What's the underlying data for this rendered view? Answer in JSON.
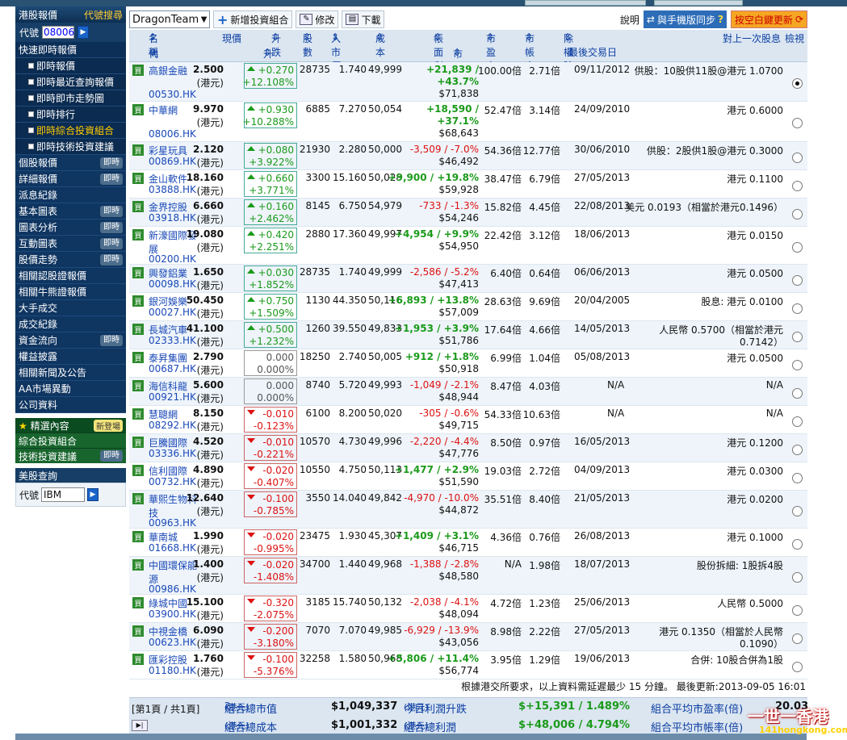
{
  "sidebar": {
    "title": "港股報價",
    "search_link": "代號搜尋",
    "code_label": "代號",
    "code_value": "08006",
    "sections": [
      {
        "label": "快速即時報價",
        "badge": ""
      }
    ],
    "subitems": [
      "即時報價",
      "即時最近查詢報價",
      "即時即市走勢圖",
      "即時排行",
      "即時綜合投資組合",
      "即時技術投資建議"
    ],
    "active_sub": 4,
    "items": [
      {
        "label": "個股報價",
        "badge": "即時"
      },
      {
        "label": "詳細報價",
        "badge": "即時"
      },
      {
        "label": "派息紀錄",
        "badge": ""
      },
      {
        "label": "基本圖表",
        "badge": "即時"
      },
      {
        "label": "圖表分析",
        "badge": "即時"
      },
      {
        "label": "互動圖表",
        "badge": "即時"
      },
      {
        "label": "股價走勢",
        "badge": "即時"
      },
      {
        "label": "相關認股證報價",
        "badge": ""
      },
      {
        "label": "相關牛熊證報價",
        "badge": ""
      },
      {
        "label": "大手成交",
        "badge": ""
      },
      {
        "label": "成交紀錄",
        "badge": ""
      },
      {
        "label": "資金流向",
        "badge": "即時"
      },
      {
        "label": "權益披露",
        "badge": ""
      },
      {
        "label": "相關新聞及公告",
        "badge": ""
      },
      {
        "label": "AA市場異動",
        "badge": ""
      },
      {
        "label": "公司資料",
        "badge": ""
      }
    ],
    "featured": {
      "title": "精選內容",
      "new_badge": "新登場"
    },
    "green_items": [
      {
        "label": "綜合投資組合",
        "badge": ""
      },
      {
        "label": "技術投資建議",
        "badge": "即時"
      }
    ],
    "us": {
      "title": "美股查詢",
      "code_label": "代號",
      "code_value": "IBM"
    }
  },
  "toolbar": {
    "portfolio": "DragonTeam",
    "new_portfolio": "新增投資組合",
    "edit": "修改",
    "download": "下載",
    "help": "說明",
    "sync": "與手機版同步",
    "update": "按空白鍵更新"
  },
  "header": {
    "name": "名稱",
    "code": "代號",
    "price": "現價",
    "change": "升跌",
    "change_pct": "升跌%",
    "shares": "股數",
    "buy_price": "入市價",
    "cost": "成本",
    "book_pl": "帳面利潤/",
    "market_value": "市值",
    "pe": "市盈率",
    "pb": "市帳率",
    "ex_date": "除權除息日/",
    "last_trade": "最後交易日",
    "last_div": "對上一次股息",
    "check": "檢視"
  },
  "buy_label": "買",
  "unit": "(港元)",
  "rows": [
    {
      "name": "高銀金融",
      "code": "00530.HK",
      "price": "2.500",
      "chg": "+0.270",
      "pct": "+12.108%",
      "dir": "up",
      "shares": "28735",
      "bp": "1.740",
      "cost": "49,999",
      "pl": "+21,839 /",
      "pl_pct": "+43.7%",
      "mv": "$71,838",
      "pe": "100.00倍",
      "pb": "2.71倍",
      "date": "09/11/2012",
      "div": "供股：10股供11股@港元 1.0700",
      "div2": "",
      "sel": true,
      "h": 49
    },
    {
      "name": "中華網",
      "code": "08006.HK",
      "price": "9.970",
      "chg": "+0.930",
      "pct": "+10.288%",
      "dir": "up",
      "shares": "6885",
      "bp": "7.270",
      "cost": "50,054",
      "pl": "+18,590 /",
      "pl_pct": "+37.1%",
      "mv": "$68,643",
      "pe": "52.47倍",
      "pb": "3.14倍",
      "date": "24/09/2010",
      "div": "港元 0.6000",
      "div2": "",
      "sel": false,
      "h": 50
    },
    {
      "name": "彩星玩具",
      "code": "00869.HK",
      "price": "2.120",
      "chg": "+0.080",
      "pct": "+3.922%",
      "dir": "up",
      "shares": "21930",
      "bp": "2.280",
      "cost": "50,000",
      "pl": "-3,509 / -7.0%",
      "pl_pct": "",
      "mv": "$46,492",
      "pe": "54.36倍",
      "pb": "12.77倍",
      "date": "30/06/2010",
      "div": "供股：2股供1股@港元 0.3000",
      "div2": "",
      "sel": false,
      "h": 35
    },
    {
      "name": "金山軟件",
      "code": "03888.HK",
      "price": "18.160",
      "chg": "+0.660",
      "pct": "+3.771%",
      "dir": "up",
      "shares": "3300",
      "bp": "15.160",
      "cost": "50,028",
      "pl": "+9,900 / +19.8%",
      "pl_pct": "",
      "mv": "$59,928",
      "pe": "38.47倍",
      "pb": "6.79倍",
      "date": "27/05/2013",
      "div": "港元 0.1100",
      "div2": "",
      "sel": false,
      "h": 35
    },
    {
      "name": "金界控股",
      "code": "03918.HK",
      "price": "6.660",
      "chg": "+0.160",
      "pct": "+2.462%",
      "dir": "up",
      "shares": "8145",
      "bp": "6.750",
      "cost": "54,979",
      "pl": "-733 / -1.3%",
      "pl_pct": "",
      "mv": "$54,246",
      "pe": "15.82倍",
      "pb": "4.45倍",
      "date": "22/08/2013",
      "div": "美元 0.0193（相當於港元0.1496）",
      "div2": "",
      "sel": false,
      "h": 35
    },
    {
      "name": "新濠國際發展",
      "code": "00200.HK",
      "price": "19.080",
      "chg": "+0.420",
      "pct": "+2.251%",
      "dir": "up",
      "shares": "2880",
      "bp": "17.360",
      "cost": "49,997",
      "pl": "+4,954 / +9.9%",
      "pl_pct": "",
      "mv": "$54,950",
      "pe": "22.42倍",
      "pb": "3.12倍",
      "date": "18/06/2013",
      "div": "港元 0.0150",
      "div2": "",
      "sel": false,
      "h": 47
    },
    {
      "name": "興發鋁業",
      "code": "00098.HK",
      "price": "1.650",
      "chg": "+0.030",
      "pct": "+1.852%",
      "dir": "up",
      "shares": "28735",
      "bp": "1.740",
      "cost": "49,999",
      "pl": "-2,586 / -5.2%",
      "pl_pct": "",
      "mv": "$47,413",
      "pe": "6.40倍",
      "pb": "0.64倍",
      "date": "06/06/2013",
      "div": "港元 0.0500",
      "div2": "",
      "sel": false,
      "h": 35
    },
    {
      "name": "銀河娛樂",
      "code": "00027.HK",
      "price": "50.450",
      "chg": "+0.750",
      "pct": "+1.509%",
      "dir": "up",
      "shares": "1130",
      "bp": "44.350",
      "cost": "50,116",
      "pl": "+6,893 / +13.8%",
      "pl_pct": "",
      "mv": "$57,009",
      "pe": "28.63倍",
      "pb": "9.69倍",
      "date": "20/04/2005",
      "div": "股息: 港元 0.0100",
      "div2": "",
      "sel": false,
      "h": 35
    },
    {
      "name": "長城汽車",
      "code": "02333.HK",
      "price": "41.100",
      "chg": "+0.500",
      "pct": "+1.232%",
      "dir": "up",
      "shares": "1260",
      "bp": "39.550",
      "cost": "49,833",
      "pl": "+1,953 / +3.9%",
      "pl_pct": "",
      "mv": "$51,786",
      "pe": "17.64倍",
      "pb": "4.66倍",
      "date": "14/05/2013",
      "div": "人民幣 0.5700（相當於港元",
      "div2": "0.7142）",
      "sel": false,
      "h": 35
    },
    {
      "name": "泰昇集團",
      "code": "00687.HK",
      "price": "2.790",
      "chg": "0.000",
      "pct": "0.000%",
      "dir": "zero",
      "shares": "18250",
      "bp": "2.740",
      "cost": "50,005",
      "pl": "+912 / +1.8%",
      "pl_pct": "",
      "mv": "$50,918",
      "pe": "6.99倍",
      "pb": "1.04倍",
      "date": "05/08/2013",
      "div": "港元 0.0500",
      "div2": "",
      "sel": false,
      "h": 35
    },
    {
      "name": "海信科龍",
      "code": "00921.HK",
      "price": "5.600",
      "chg": "0.000",
      "pct": "0.000%",
      "dir": "zero",
      "shares": "8740",
      "bp": "5.720",
      "cost": "49,993",
      "pl": "-1,049 / -2.1%",
      "pl_pct": "",
      "mv": "$48,944",
      "pe": "8.47倍",
      "pb": "4.03倍",
      "date": "N/A",
      "div": "N/A",
      "div2": "",
      "sel": false,
      "h": 35
    },
    {
      "name": "慧聰網",
      "code": "08292.HK",
      "price": "8.150",
      "chg": "-0.010",
      "pct": "-0.123%",
      "dir": "dn",
      "shares": "6100",
      "bp": "8.200",
      "cost": "50,020",
      "pl": "-305 / -0.6%",
      "pl_pct": "",
      "mv": "$49,715",
      "pe": "54.33倍",
      "pb": "10.63倍",
      "date": "N/A",
      "div": "N/A",
      "div2": "",
      "sel": false,
      "h": 35
    },
    {
      "name": "巨騰國際",
      "code": "03336.HK",
      "price": "4.520",
      "chg": "-0.010",
      "pct": "-0.221%",
      "dir": "dn",
      "shares": "10570",
      "bp": "4.730",
      "cost": "49,996",
      "pl": "-2,220 / -4.4%",
      "pl_pct": "",
      "mv": "$47,776",
      "pe": "8.50倍",
      "pb": "0.97倍",
      "date": "16/05/2013",
      "div": "港元 0.1200",
      "div2": "",
      "sel": false,
      "h": 35
    },
    {
      "name": "信利國際",
      "code": "00732.HK",
      "price": "4.890",
      "chg": "-0.020",
      "pct": "-0.407%",
      "dir": "dn",
      "shares": "10550",
      "bp": "4.750",
      "cost": "50,113",
      "pl": "+1,477 / +2.9%",
      "pl_pct": "",
      "mv": "$51,590",
      "pe": "19.03倍",
      "pb": "2.72倍",
      "date": "04/09/2013",
      "div": "港元 0.0300",
      "div2": "",
      "sel": false,
      "h": 35
    },
    {
      "name": "華熙生物科技",
      "code": "00963.HK",
      "price": "12.640",
      "chg": "-0.100",
      "pct": "-0.785%",
      "dir": "dn",
      "shares": "3550",
      "bp": "14.040",
      "cost": "49,842",
      "pl": "-4,970 / -10.0%",
      "pl_pct": "",
      "mv": "$44,872",
      "pe": "35.51倍",
      "pb": "8.40倍",
      "date": "21/05/2013",
      "div": "港元 0.0200",
      "div2": "",
      "sel": false,
      "h": 47
    },
    {
      "name": "華南城",
      "code": "01668.HK",
      "price": "1.990",
      "chg": "-0.020",
      "pct": "-0.995%",
      "dir": "dn",
      "shares": "23475",
      "bp": "1.930",
      "cost": "45,307",
      "pl": "+1,409 / +3.1%",
      "pl_pct": "",
      "mv": "$46,715",
      "pe": "4.36倍",
      "pb": "0.76倍",
      "date": "26/08/2013",
      "div": "港元 0.1000",
      "div2": "",
      "sel": false,
      "h": 35
    },
    {
      "name": "中國環保能源",
      "code": "00986.HK",
      "price": "1.400",
      "chg": "-0.020",
      "pct": "-1.408%",
      "dir": "dn",
      "shares": "34700",
      "bp": "1.440",
      "cost": "49,968",
      "pl": "-1,388 / -2.8%",
      "pl_pct": "",
      "mv": "$48,580",
      "pe": "N/A",
      "pb": "1.98倍",
      "date": "18/07/2013",
      "div": "股份拆細: 1股拆4股",
      "div2": "",
      "sel": false,
      "h": 47
    },
    {
      "name": "綠城中國",
      "code": "03900.HK",
      "price": "15.100",
      "chg": "-0.320",
      "pct": "-2.075%",
      "dir": "dn",
      "shares": "3185",
      "bp": "15.740",
      "cost": "50,132",
      "pl": "-2,038 / -4.1%",
      "pl_pct": "",
      "mv": "$48,094",
      "pe": "4.72倍",
      "pb": "1.23倍",
      "date": "25/06/2013",
      "div": "人民幣 0.5000",
      "div2": "",
      "sel": false,
      "h": 35
    },
    {
      "name": "中視金橋",
      "code": "00623.HK",
      "price": "6.090",
      "chg": "-0.200",
      "pct": "-3.180%",
      "dir": "dn",
      "shares": "7070",
      "bp": "7.070",
      "cost": "49,985",
      "pl": "-6,929 / -13.9%",
      "pl_pct": "",
      "mv": "$43,056",
      "pe": "8.98倍",
      "pb": "2.22倍",
      "date": "27/05/2013",
      "div": "港元 0.1350（相當於人民幣",
      "div2": "0.1090）",
      "sel": false,
      "h": 35
    },
    {
      "name": "匯彩控股",
      "code": "01180.HK",
      "price": "1.760",
      "chg": "-0.100",
      "pct": "-5.376%",
      "dir": "dn",
      "shares": "32258",
      "bp": "1.580",
      "cost": "50,968",
      "pl": "+5,806 / +11.4%",
      "pl_pct": "",
      "mv": "$56,774",
      "pe": "3.95倍",
      "pb": "1.29倍",
      "date": "19/06/2013",
      "div": "合併: 10股合併為1股",
      "div2": "",
      "sel": false,
      "h": 35
    }
  ],
  "note": "根據港交所要求，以上資料需延遲最少 15 分鐘。 最後更新:2013-09-05 16:01",
  "summary": {
    "page": "[第1頁 / 共1頁]",
    "total_mv_label": "組合總市值",
    "total_mv_unit": "(港元)",
    "total_mv": "$1,049,337",
    "total_cost_label": "組合總成本",
    "total_cost_unit": "(港元)",
    "total_cost": "$1,001,332",
    "today_label": "今日利潤升跌",
    "today_unit": "(港元)",
    "today": "$+15,391 / 1.489%",
    "total_pl_label": "組合總利潤",
    "total_pl_unit": "(港元)",
    "total_pl": "$+48,006 / 4.794%",
    "avg_pe_label": "組合平均市盈率(倍)",
    "avg_pe": "20.03",
    "avg_pb_label": "組合平均市帳率(倍)"
  },
  "watermark": {
    "title": "一世一香港",
    "url": "141hongkong.com"
  }
}
